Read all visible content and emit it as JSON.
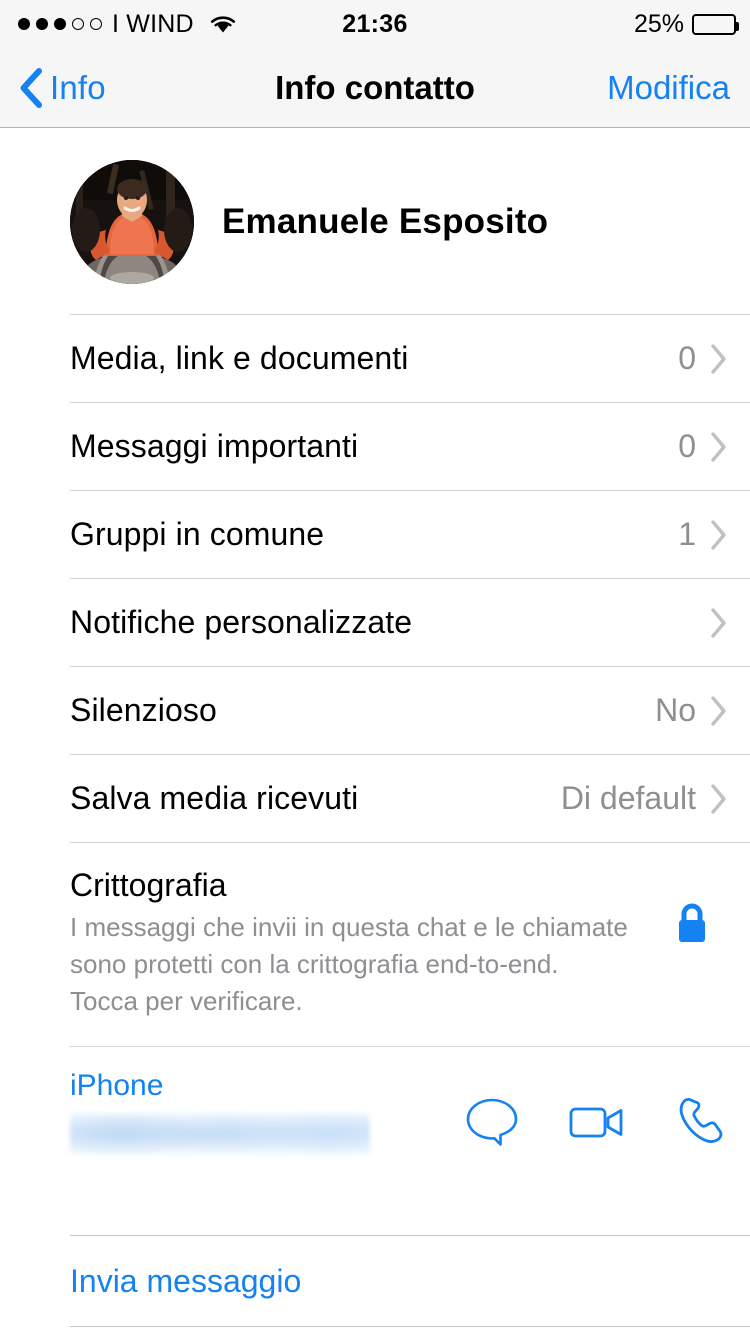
{
  "status_bar": {
    "signal_dots_filled": 3,
    "signal_dots_total": 5,
    "carrier": "I WIND",
    "wifi_icon": "wifi-icon",
    "time": "21:36",
    "battery_percent_label": "25%",
    "battery_level": 25
  },
  "nav": {
    "back_label": "Info",
    "back_icon": "chevron-left-icon",
    "title": "Info contatto",
    "edit_label": "Modifica"
  },
  "contact": {
    "name": "Emanuele Esposito",
    "avatar_icon": "contact-avatar"
  },
  "rows": [
    {
      "label": "Media, link e documenti",
      "value": "0"
    },
    {
      "label": "Messaggi importanti",
      "value": "0"
    },
    {
      "label": "Gruppi in comune",
      "value": "1"
    },
    {
      "label": "Notifiche personalizzate",
      "value": ""
    },
    {
      "label": "Silenzioso",
      "value": "No"
    },
    {
      "label": "Salva media ricevuti",
      "value": "Di default"
    }
  ],
  "encryption": {
    "title": "Crittografia",
    "description": "I messaggi che invii in questa chat e le chiamate sono protetti con la crittografia end-to-end. Tocca per verificare.",
    "icon": "lock-icon"
  },
  "phone": {
    "label": "iPhone",
    "number": "",
    "number_redacted": true,
    "actions": [
      {
        "icon": "chat-bubble-icon",
        "name": "message"
      },
      {
        "icon": "video-camera-icon",
        "name": "video-call"
      },
      {
        "icon": "phone-handset-icon",
        "name": "voice-call"
      }
    ]
  },
  "send_message": {
    "label": "Invia messaggio"
  },
  "colors": {
    "accent_blue": "#1482f0",
    "value_gray": "#8e8e93",
    "chevron_gray": "#c7c7cc",
    "separator": "#d6d6d6",
    "bar_background": "#f6f6f6"
  }
}
